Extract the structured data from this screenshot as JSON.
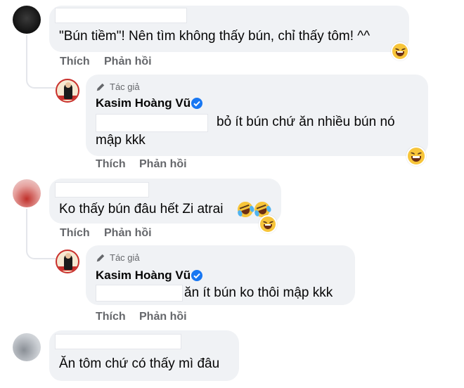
{
  "actions": {
    "like": "Thích",
    "reply": "Phản hồi"
  },
  "comments": [
    {
      "text": "\"Bún tiềm\"! Nên tìm không thấy bún, chỉ thấy tôm! ^^",
      "reaction_icon": "laughing-face-emoji",
      "reply": {
        "author_badge": "Tác giả",
        "author_name": "Kasim Hoàng Vũ",
        "text_line1": "bỏ ít bún chứ ăn nhiều bún nó",
        "text_line2": "mập kkk",
        "reaction_icon": "laughing-face-emoji"
      }
    },
    {
      "text": "Ko thấy bún đâu hết Zi atrai",
      "inline_emojis": [
        "rolling-on-floor-laughing-emoji",
        "rolling-on-floor-laughing-emoji"
      ],
      "reaction_icon": "laughing-face-emoji",
      "reply": {
        "author_badge": "Tác giả",
        "author_name": "Kasim Hoàng Vũ",
        "text_line1": "ăn ít bún ko thôi mập kkk"
      }
    },
    {
      "text": "Ăn tôm chứ có thấy mì đâu"
    }
  ],
  "colors": {
    "bubble": "#f0f2f5",
    "secondary_text": "#65676b",
    "verified": "#1877f2",
    "emoji": "#f7c53a"
  }
}
